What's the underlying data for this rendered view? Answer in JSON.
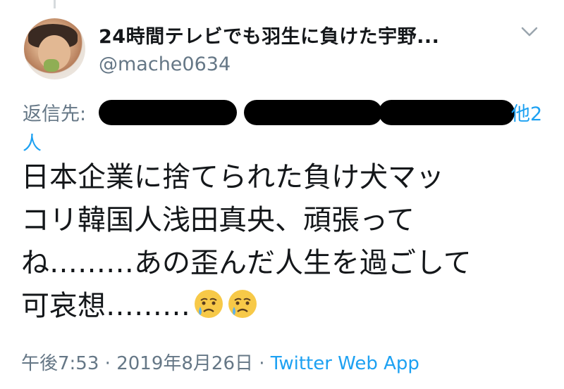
{
  "tweet": {
    "display_name": "24時間テレビでも羽生に負けた宇野...",
    "handle": "@mache0634",
    "reply_label": "返信先:",
    "reply_other": "他2",
    "reply_count_suffix": "人",
    "text": "日本企業に捨てられた負け犬マッ\nコリ韓国人浅田真央、頑張って\nね………あの歪んだ人生を過ごして\n可哀想………",
    "emojis": [
      "crying-face-emoji",
      "crying-face-emoji"
    ],
    "time": "午後7:53",
    "date": "2019年8月26日",
    "separator": "·",
    "source": "Twitter Web App"
  },
  "colors": {
    "text": "#14171a",
    "secondary": "#657786",
    "link": "#1da1f2",
    "redaction": "#000000"
  },
  "icons": {
    "menu": "chevron-down-icon"
  }
}
